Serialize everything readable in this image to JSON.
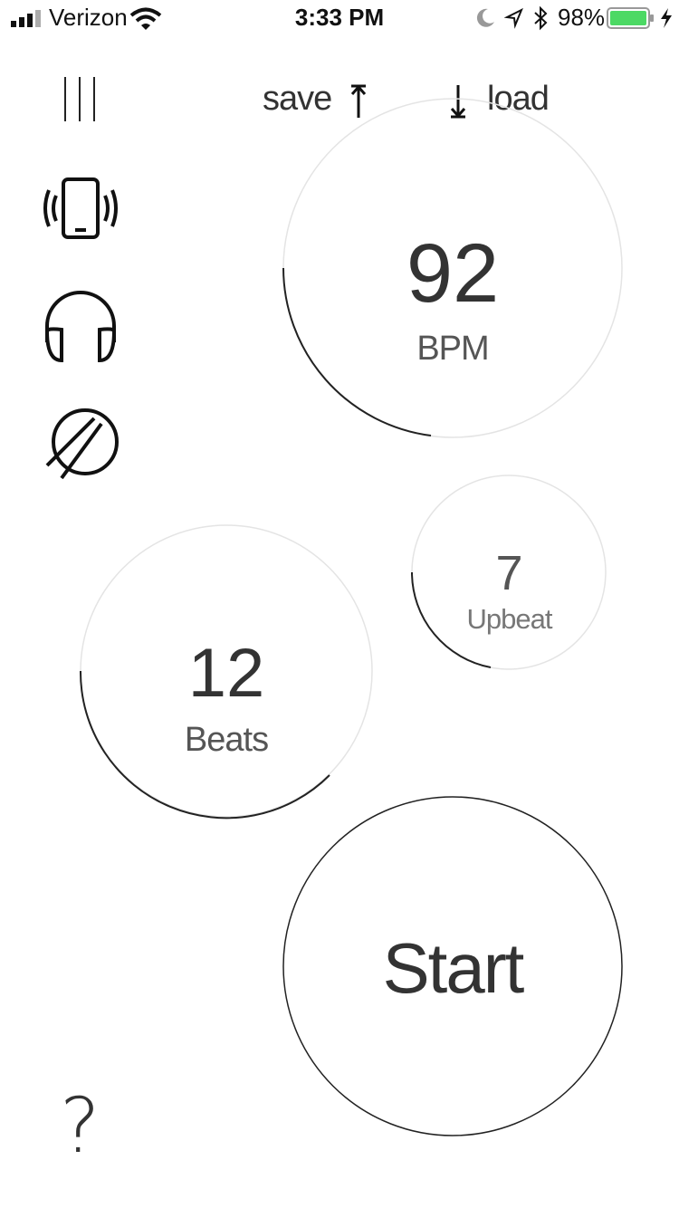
{
  "status_bar": {
    "carrier": "Verizon",
    "time": "3:33 PM",
    "battery_percent": "98%",
    "battery_color": "#4cd964"
  },
  "toolbar": {
    "save_label": "save",
    "load_label": "load"
  },
  "sidebar": {
    "items": [
      {
        "name": "menu-icon"
      },
      {
        "name": "vibrate-phone-icon"
      },
      {
        "name": "headphones-icon"
      },
      {
        "name": "drum-icon"
      }
    ]
  },
  "tempo": {
    "value": "92",
    "label": "BPM"
  },
  "upbeat": {
    "value": "7",
    "label": "Upbeat"
  },
  "beats": {
    "value": "12",
    "label": "Beats"
  },
  "start": {
    "label": "Start"
  },
  "help": {
    "label": "?"
  }
}
